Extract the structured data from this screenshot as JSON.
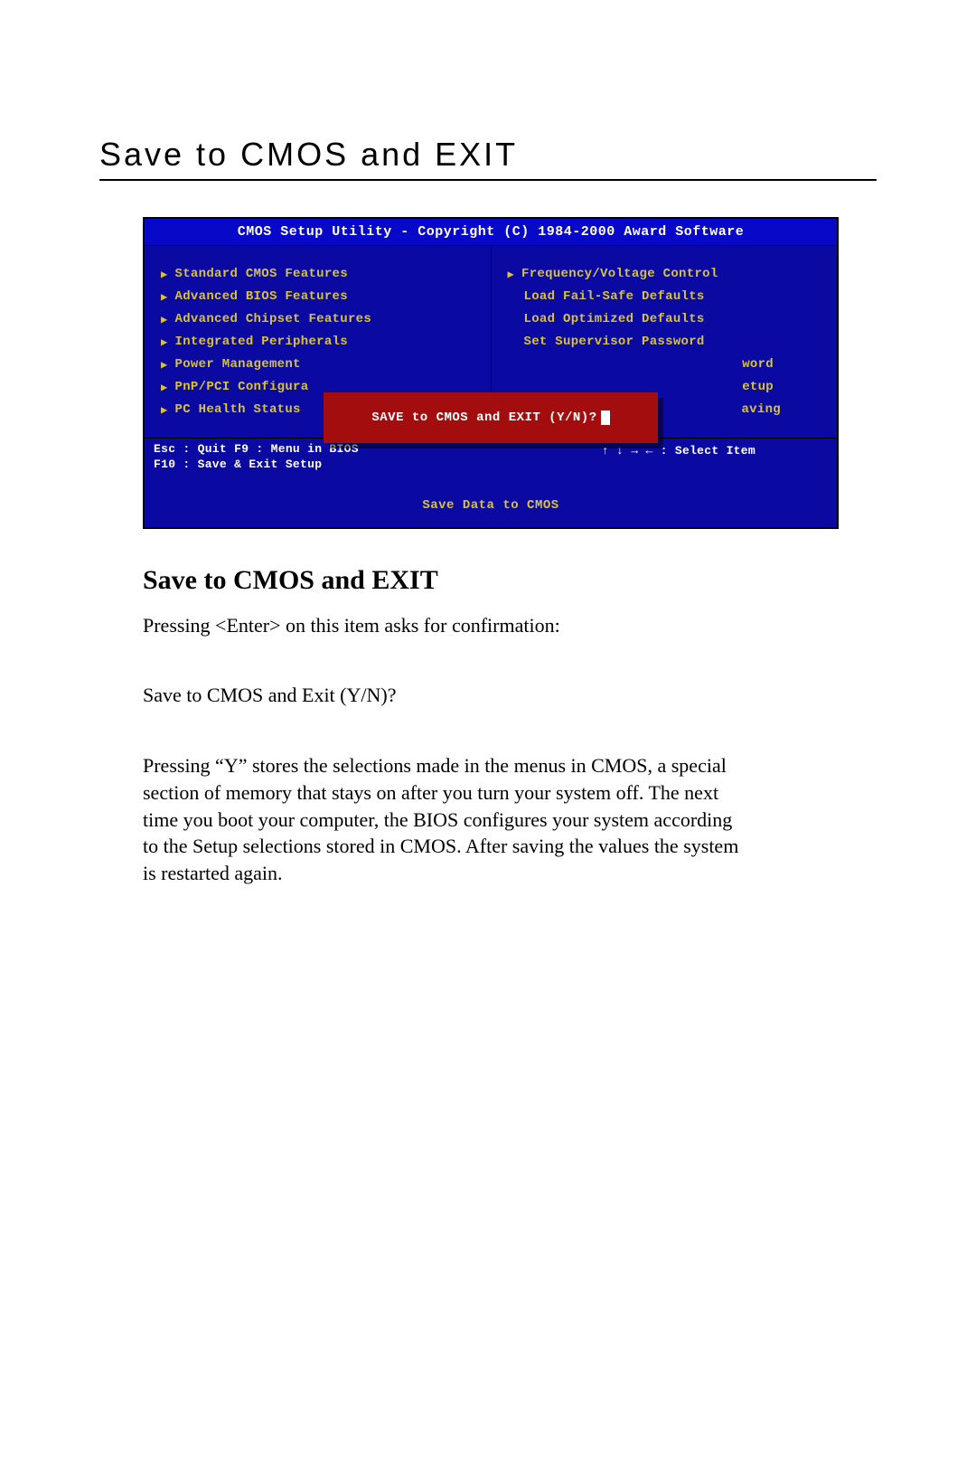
{
  "page": {
    "title": "Save to CMOS and EXIT"
  },
  "bios": {
    "titlebar": "CMOS Setup Utility - Copyright (C) 1984-2000 Award Software",
    "menu_left": [
      "Standard CMOS Features",
      "Advanced BIOS Features",
      "Advanced Chipset Features",
      "Integrated Peripherals",
      "Power Management",
      "PnP/PCI Configura",
      "PC Health Status"
    ],
    "menu_right": [
      {
        "tri": true,
        "label": "Frequency/Voltage Control"
      },
      {
        "tri": false,
        "label": "Load Fail-Safe Defaults"
      },
      {
        "tri": false,
        "label": "Load Optimized Defaults"
      },
      {
        "tri": false,
        "label": "Set Supervisor Password"
      },
      {
        "tri": false,
        "label": "word"
      },
      {
        "tri": false,
        "label": "etup"
      },
      {
        "tri": false,
        "label": "aving"
      }
    ],
    "dialog": "SAVE to CMOS and EXIT (Y/N)?",
    "help_left_line1": "Esc : Quit      F9 : Menu in BIOS",
    "help_left_line2": "F10 : Save & Exit Setup",
    "help_right": "↑ ↓ → ←   : Select Item",
    "footer": "Save Data to CMOS"
  },
  "doc": {
    "section_title": "Save to CMOS and EXIT",
    "para1": "Pressing <Enter> on this item asks for confirmation:",
    "para2": "Save to CMOS and Exit (Y/N)?",
    "para3": "Pressing “Y” stores the selections made in the menus in CMOS, a special section of memory that stays on after you turn your system off.  The next time you boot your computer, the BIOS configures your system according to the Setup selections stored in CMOS. After saving the values the system is restarted again."
  }
}
